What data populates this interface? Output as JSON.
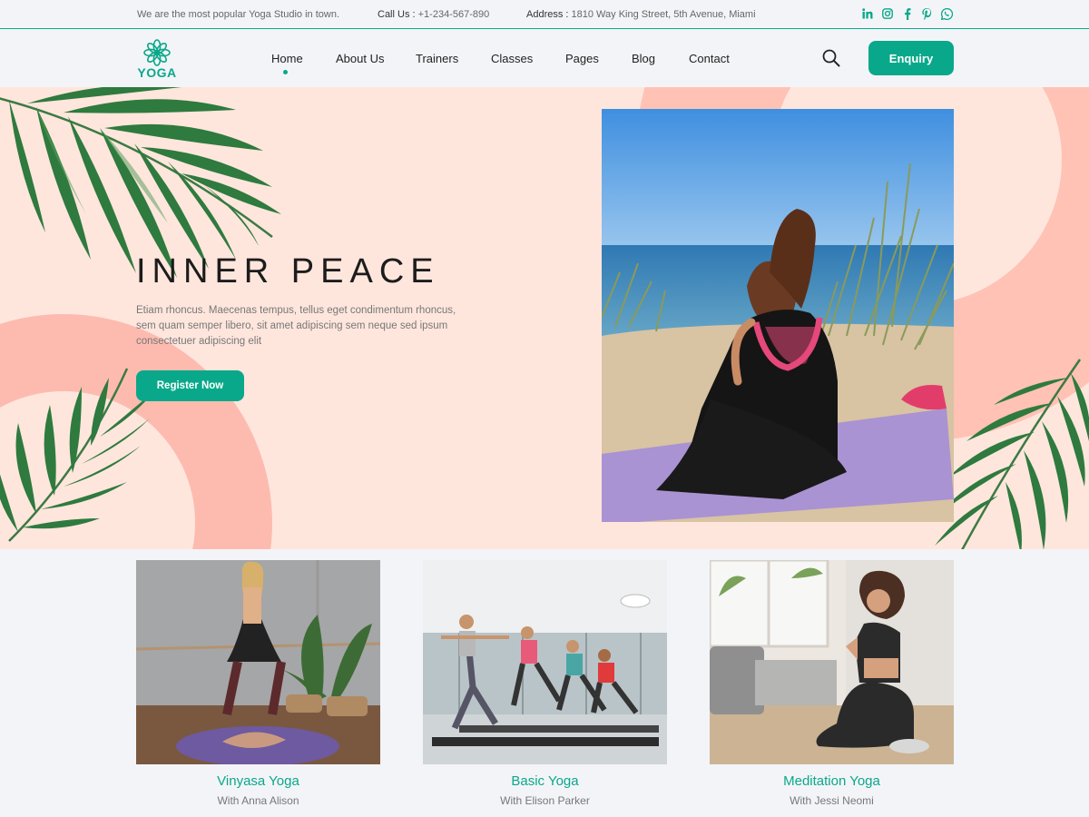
{
  "topbar": {
    "tagline": "We are the most popular Yoga Studio in town.",
    "call_label": "Call Us :",
    "call_value": "+1-234-567-890",
    "address_label": "Address :",
    "address_value": "1810 Way King Street, 5th Avenue, Miami",
    "social": [
      "linkedin-icon",
      "instagram-icon",
      "facebook-icon",
      "pinterest-icon",
      "whatsapp-icon"
    ]
  },
  "nav": {
    "logo_text": "YOGA",
    "items": [
      {
        "label": "Home",
        "active": true
      },
      {
        "label": "About Us"
      },
      {
        "label": "Trainers"
      },
      {
        "label": "Classes"
      },
      {
        "label": "Pages"
      },
      {
        "label": "Blog"
      },
      {
        "label": "Contact"
      }
    ],
    "enquiry_label": "Enquiry"
  },
  "hero": {
    "title": "INNER PEACE",
    "description": "Etiam rhoncus. Maecenas tempus, tellus eget condimentum rhoncus, sem quam semper libero, sit amet adipiscing sem neque sed ipsum consectetuer adipiscing elit",
    "button_label": "Register Now"
  },
  "classes": [
    {
      "title": "Vinyasa Yoga",
      "trainer": "With Anna Alison"
    },
    {
      "title": "Basic Yoga",
      "trainer": "With Elison Parker"
    },
    {
      "title": "Meditation Yoga",
      "trainer": "With Jessi Neomi"
    }
  ],
  "colors": {
    "accent": "#0aa88a",
    "hero_bg": "#ffe6dd",
    "hero_shape": "#fdbbb0",
    "page_bg": "#f3f4f8"
  }
}
